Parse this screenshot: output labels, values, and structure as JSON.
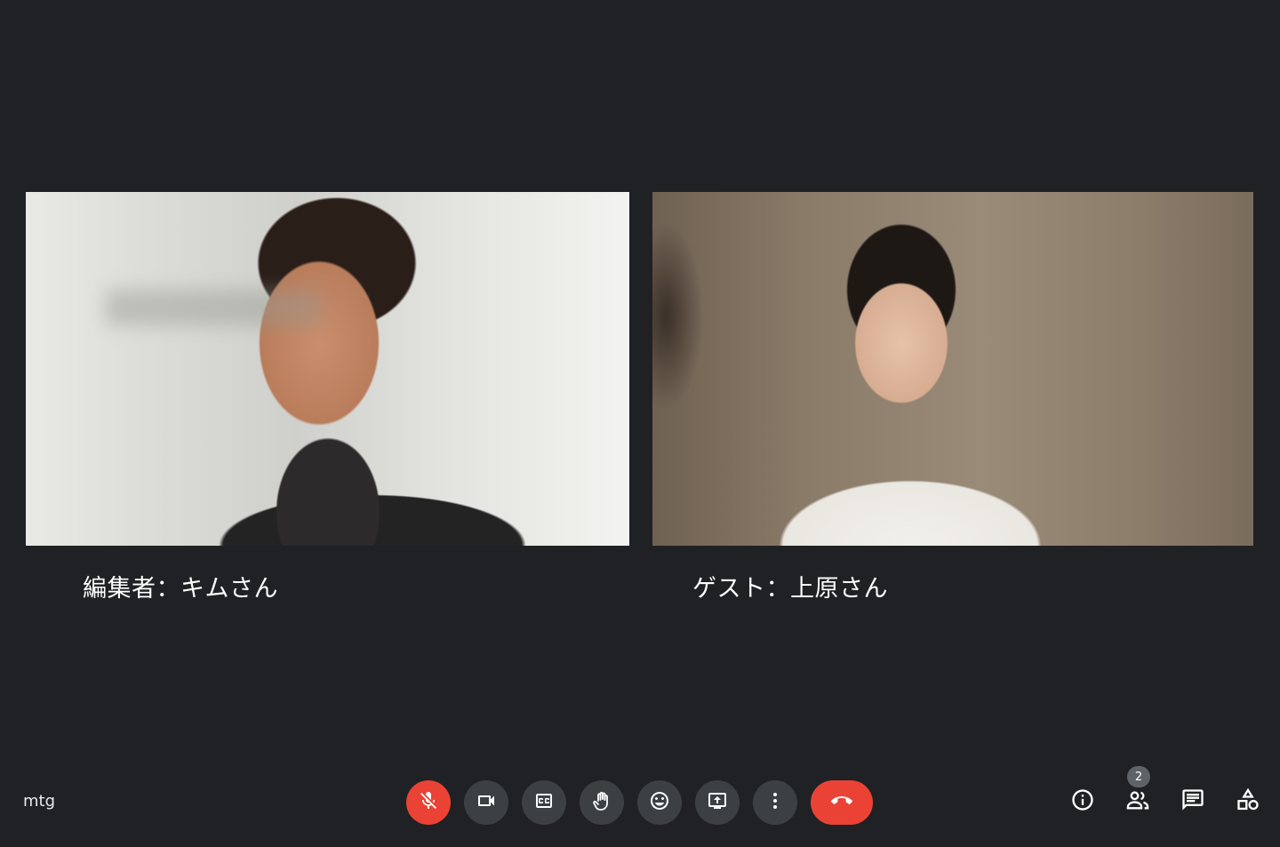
{
  "participants": [
    {
      "name_label": "編集者：キムさん"
    },
    {
      "name_label": "ゲスト：上原さん"
    }
  ],
  "meeting": {
    "code": "mtg"
  },
  "controls": [
    {
      "icon": "mic-off-icon",
      "state": "muted"
    },
    {
      "icon": "camera-icon"
    },
    {
      "icon": "captions-icon"
    },
    {
      "icon": "raise-hand-icon"
    },
    {
      "icon": "emoji-icon"
    },
    {
      "icon": "present-screen-icon"
    },
    {
      "icon": "more-options-icon"
    },
    {
      "icon": "hang-up-icon"
    }
  ],
  "side_panel": {
    "people_count": "2",
    "icons": [
      "info-icon",
      "people-icon",
      "chat-icon",
      "activities-icon"
    ]
  },
  "colors": {
    "background": "#202124",
    "button": "#3c4043",
    "danger": "#ea4335"
  }
}
